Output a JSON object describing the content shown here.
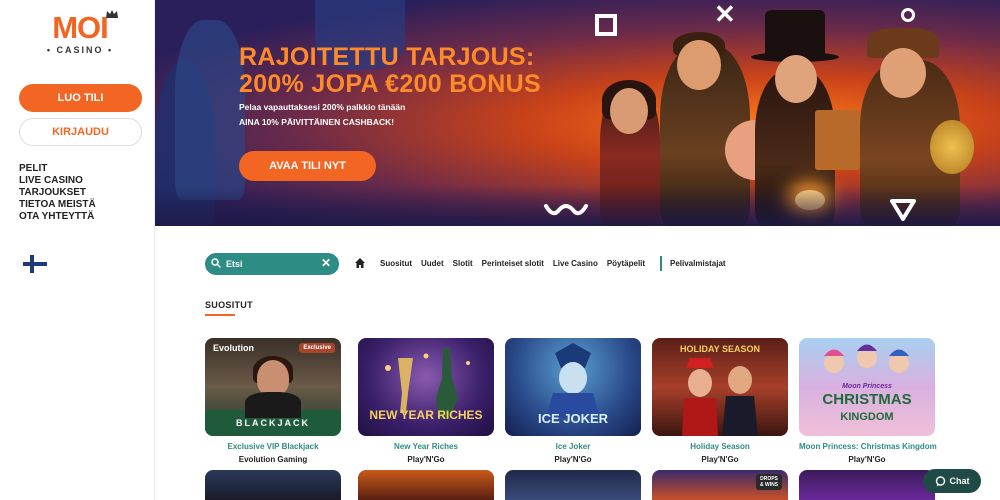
{
  "sidebar": {
    "logo_main": "MOI",
    "logo_sub": "CASINO",
    "register_label": "LUO TILI",
    "login_label": "KIRJAUDU",
    "nav": [
      "PELIT",
      "LIVE CASINO",
      "TARJOUKSET",
      "TIETOA MEISTÄ",
      "OTA YHTEYTTÄ"
    ],
    "language_icon": "finland-flag-icon"
  },
  "hero": {
    "title_line1": "RAJOITETTU TARJOUS:",
    "title_line2": "200% JOPA €200 BONUS",
    "sub_line1": "Pelaa vapauttaksesi 200% palkkio tänään",
    "sub_line2": "AINA 10% PÄIVITTÄINEN CASHBACK!",
    "cta_label": "AVAA TILI NYT"
  },
  "search": {
    "placeholder": "Etsi"
  },
  "categories": [
    "Suositut",
    "Uudet",
    "Slotit",
    "Perinteiset slotit",
    "Live Casino",
    "Pöytäpelit"
  ],
  "providers_label": "Pelivalmistajat",
  "section_title": "SUOSITUT",
  "games": [
    {
      "name": "Exclusive VIP Blackjack",
      "provider": "Evolution Gaming",
      "art_title": "BLACKJACK",
      "brand": "Evolution",
      "badge": "Exclusive"
    },
    {
      "name": "New Year Riches",
      "provider": "Play'N'Go",
      "art_title": "NEW YEAR RICHES"
    },
    {
      "name": "Ice Joker",
      "provider": "Play'N'Go",
      "art_title": "ICE JOKER"
    },
    {
      "name": "Holiday Season",
      "provider": "Play'N'Go",
      "art_title": "HOLIDAY SEASON"
    },
    {
      "name": "Moon Princess: Christmas Kingdom",
      "provider": "Play'N'Go",
      "art_title_line1": "Moon Princess",
      "art_title_line2": "CHRISTMAS",
      "art_title_line3": "KINGDOM"
    }
  ],
  "row2_badge": "DROPS & WINS",
  "chat_label": "Chat",
  "colors": {
    "brand": "#f26522",
    "teal": "#2d8c83",
    "text": "#222222"
  }
}
